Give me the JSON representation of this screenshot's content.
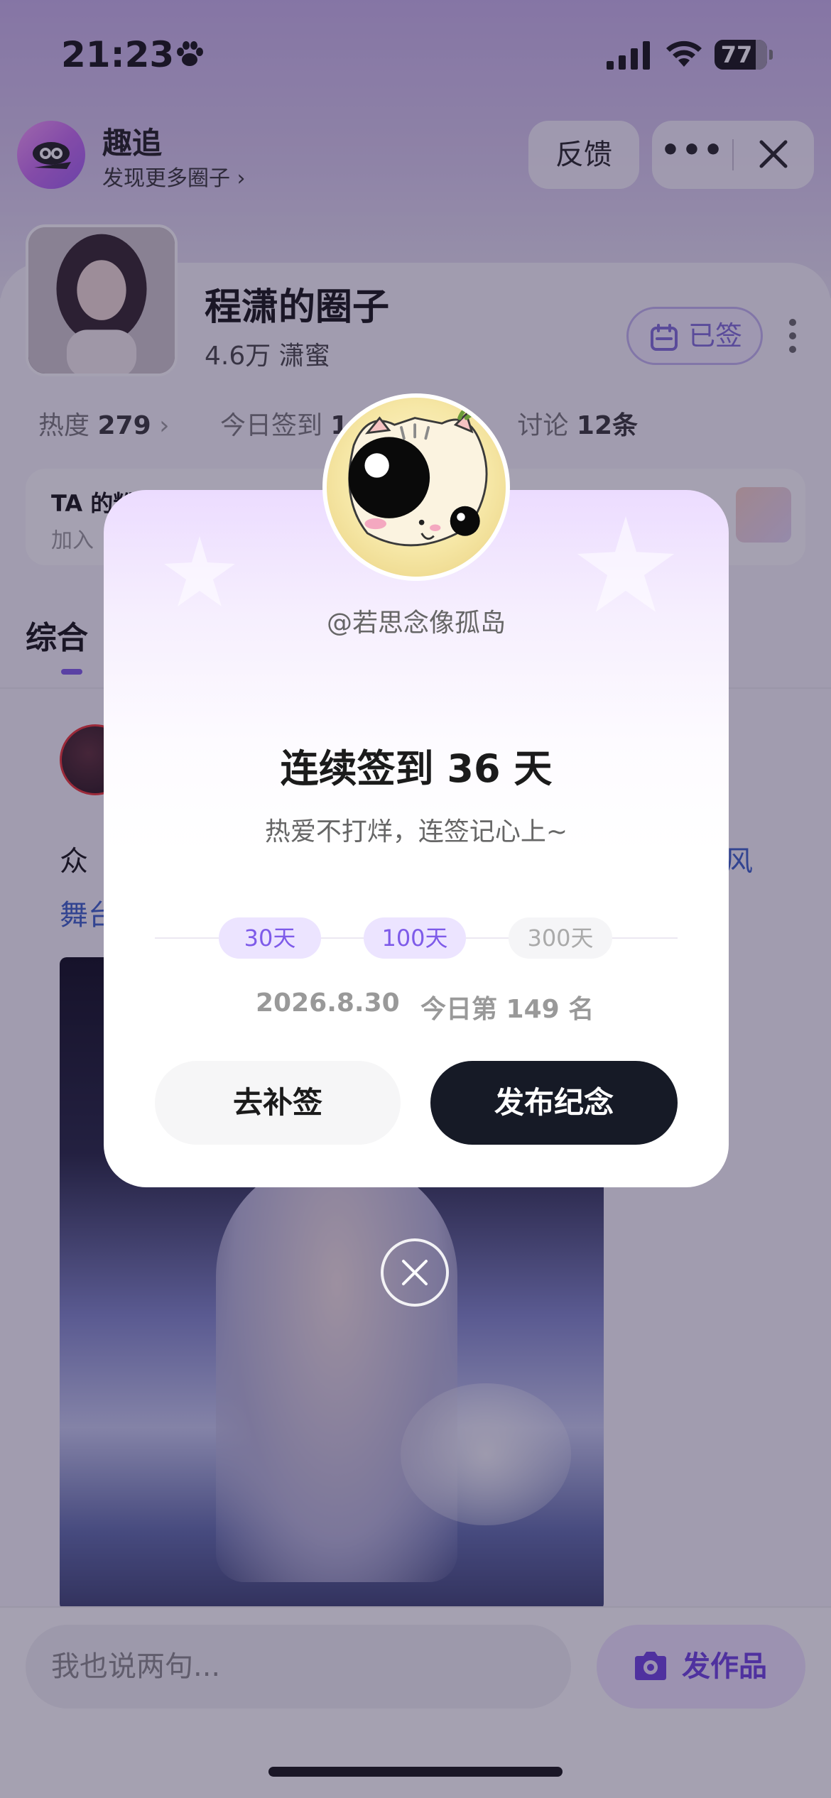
{
  "status_bar": {
    "time": "21:23",
    "battery": "77"
  },
  "app_header": {
    "name": "趣追",
    "subtitle": "发现更多圈子 ›",
    "feedback_label": "反馈",
    "more_label": "•••"
  },
  "circle": {
    "name": "程潇的圈子",
    "meta": "4.6万  潇蜜",
    "signed_label": "已签",
    "stats": {
      "heat_label": "热度",
      "heat_value": "279",
      "checkin_label": "今日签到",
      "checkin_value": "14",
      "discuss_label": "讨论",
      "discuss_value": "12条"
    },
    "ta_card": {
      "title": "TA 的粉",
      "subtitle": "加入"
    },
    "tab_active": "综合"
  },
  "post": {
    "text_line1": "众",
    "text_line2": "舞台",
    "text_right": "风"
  },
  "bottom_bar": {
    "comment_placeholder": "我也说两句...",
    "publish_work_label": "发作品"
  },
  "modal": {
    "username": "@若思念像孤岛",
    "title": "连续签到 36 天",
    "subtitle": "热爱不打烊，连签记心上~",
    "milestones": [
      {
        "label": "30天",
        "reached": true
      },
      {
        "label": "100天",
        "reached": true
      },
      {
        "label": "300天",
        "reached": false
      }
    ],
    "date": "2026.8.30",
    "rank": "今日第 149 名",
    "makeup_label": "去补签",
    "publish_label": "发布纪念"
  },
  "colors": {
    "accent": "#7e5be9",
    "dark_button": "#161a26",
    "overlay": "rgba(40,30,70,0.42)"
  }
}
